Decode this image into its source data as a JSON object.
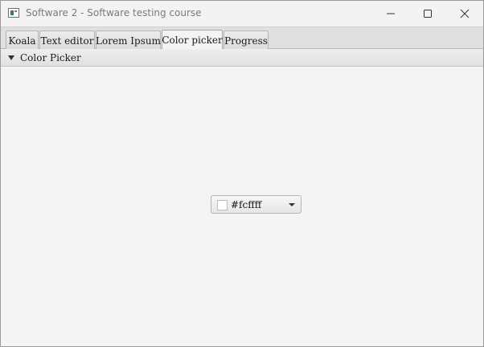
{
  "window": {
    "title": "Software 2 - Software testing course",
    "icon": "app-window-icon"
  },
  "controls": {
    "minimize_icon": "minimize-icon",
    "maximize_icon": "maximize-icon",
    "close_icon": "close-icon"
  },
  "tabs": [
    {
      "label": "Koala",
      "selected": false
    },
    {
      "label": "Text editor",
      "selected": false
    },
    {
      "label": "Lorem Ipsum",
      "selected": false
    },
    {
      "label": "Color picker",
      "selected": true
    },
    {
      "label": "Progress",
      "selected": false
    }
  ],
  "pane": {
    "title": "Color Picker",
    "expanded": true
  },
  "color_picker": {
    "value": "#fcffff",
    "swatch_color": "#fcffff"
  }
}
